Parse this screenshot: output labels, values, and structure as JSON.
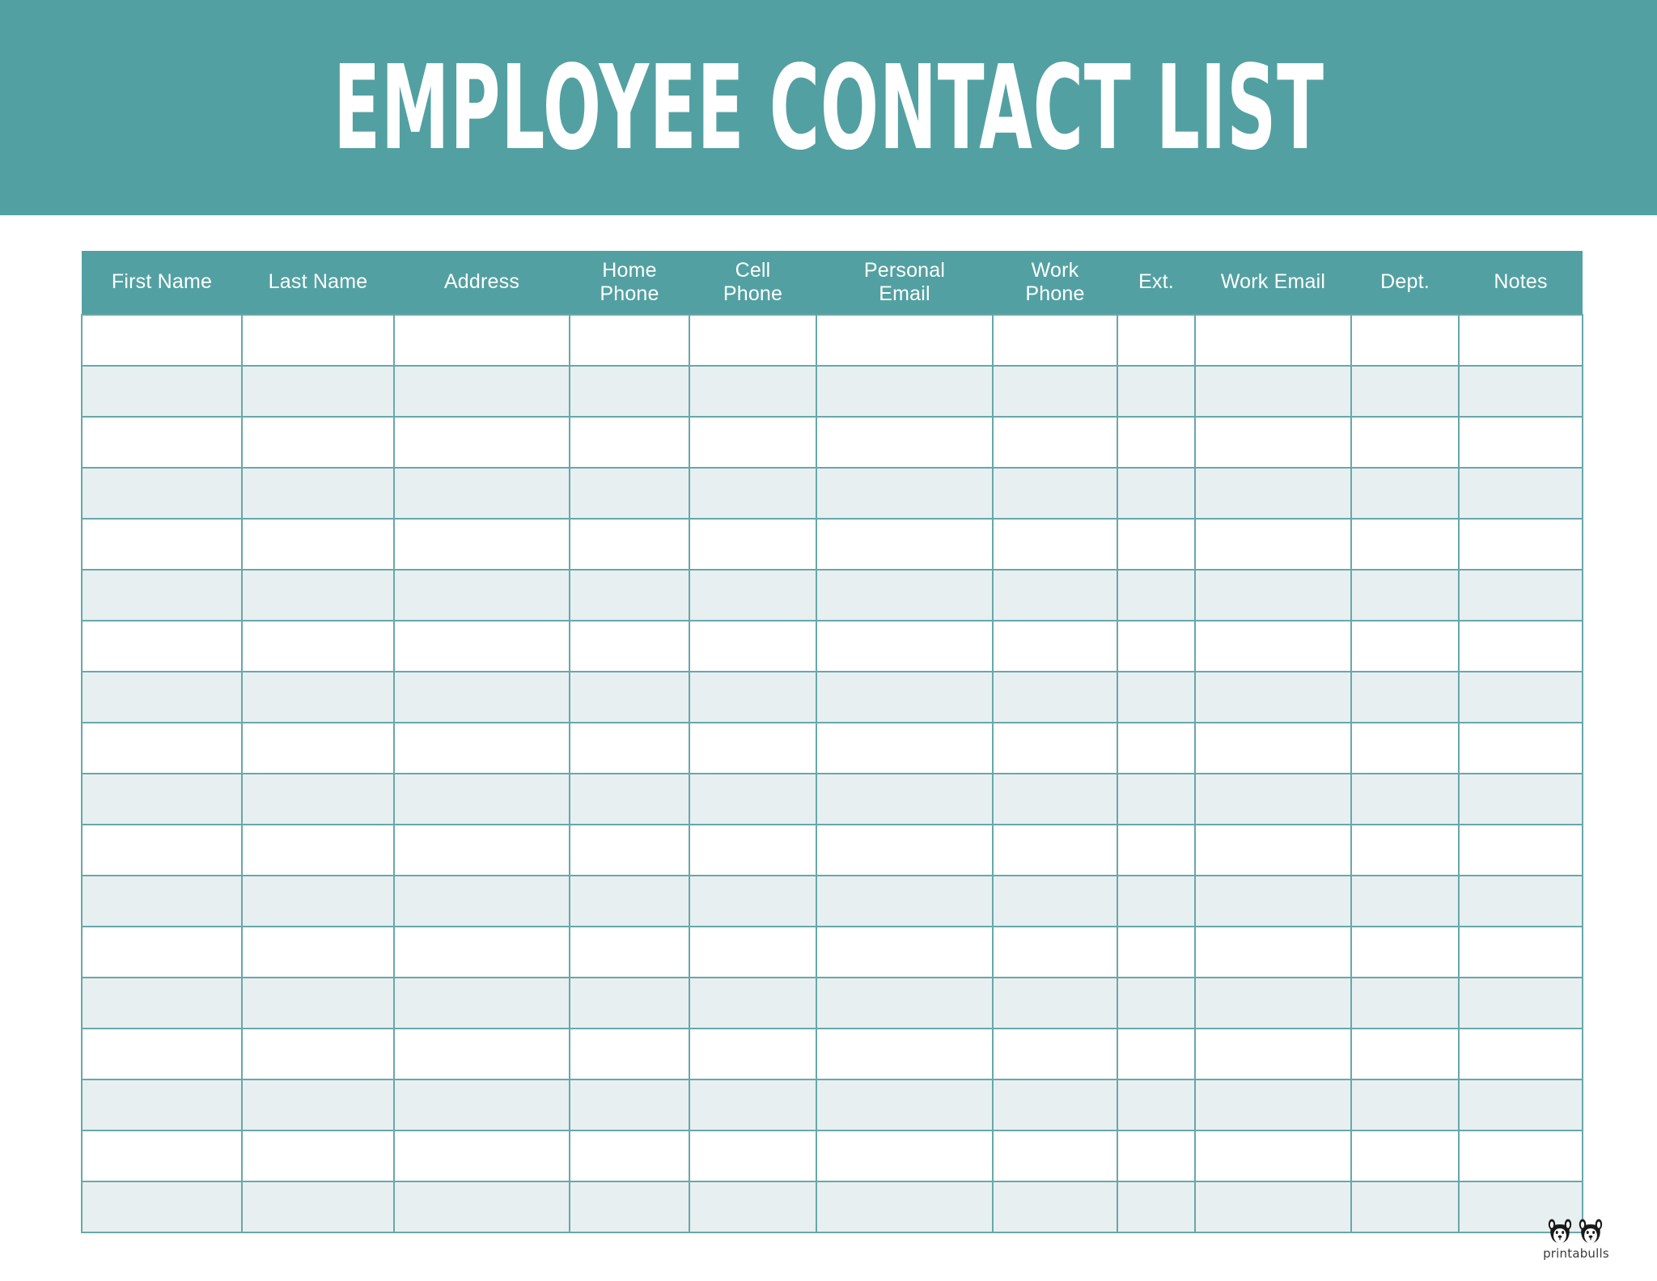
{
  "document": {
    "title": "EMPLOYEE CONTACT LIST",
    "banner_color": "#53a0a2",
    "grid_line_color": "#67a8ab",
    "alt_row_color": "#e8eff0",
    "page_background": "#ffffff"
  },
  "table": {
    "columns": [
      {
        "label": "First Name",
        "key": "first_name"
      },
      {
        "label": "Last Name",
        "key": "last_name"
      },
      {
        "label": "Address",
        "key": "address"
      },
      {
        "label": "Home\nPhone",
        "line1": "Home",
        "line2": "Phone",
        "key": "home_phone"
      },
      {
        "label": "Cell\nPhone",
        "line1": "Cell",
        "line2": "Phone",
        "key": "cell_phone"
      },
      {
        "label": "Personal\nEmail",
        "line1": "Personal",
        "line2": "Email",
        "key": "personal_email"
      },
      {
        "label": "Work\nPhone",
        "line1": "Work",
        "line2": "Phone",
        "key": "work_phone"
      },
      {
        "label": "Ext.",
        "key": "ext"
      },
      {
        "label": "Work Email",
        "key": "work_email"
      },
      {
        "label": "Dept.",
        "key": "dept"
      },
      {
        "label": "Notes",
        "key": "notes"
      }
    ],
    "row_count": 18,
    "rows": [
      {
        "first_name": "",
        "last_name": "",
        "address": "",
        "home_phone": "",
        "cell_phone": "",
        "personal_email": "",
        "work_phone": "",
        "ext": "",
        "work_email": "",
        "dept": "",
        "notes": ""
      },
      {
        "first_name": "",
        "last_name": "",
        "address": "",
        "home_phone": "",
        "cell_phone": "",
        "personal_email": "",
        "work_phone": "",
        "ext": "",
        "work_email": "",
        "dept": "",
        "notes": ""
      },
      {
        "first_name": "",
        "last_name": "",
        "address": "",
        "home_phone": "",
        "cell_phone": "",
        "personal_email": "",
        "work_phone": "",
        "ext": "",
        "work_email": "",
        "dept": "",
        "notes": ""
      },
      {
        "first_name": "",
        "last_name": "",
        "address": "",
        "home_phone": "",
        "cell_phone": "",
        "personal_email": "",
        "work_phone": "",
        "ext": "",
        "work_email": "",
        "dept": "",
        "notes": ""
      },
      {
        "first_name": "",
        "last_name": "",
        "address": "",
        "home_phone": "",
        "cell_phone": "",
        "personal_email": "",
        "work_phone": "",
        "ext": "",
        "work_email": "",
        "dept": "",
        "notes": ""
      },
      {
        "first_name": "",
        "last_name": "",
        "address": "",
        "home_phone": "",
        "cell_phone": "",
        "personal_email": "",
        "work_phone": "",
        "ext": "",
        "work_email": "",
        "dept": "",
        "notes": ""
      },
      {
        "first_name": "",
        "last_name": "",
        "address": "",
        "home_phone": "",
        "cell_phone": "",
        "personal_email": "",
        "work_phone": "",
        "ext": "",
        "work_email": "",
        "dept": "",
        "notes": ""
      },
      {
        "first_name": "",
        "last_name": "",
        "address": "",
        "home_phone": "",
        "cell_phone": "",
        "personal_email": "",
        "work_phone": "",
        "ext": "",
        "work_email": "",
        "dept": "",
        "notes": ""
      },
      {
        "first_name": "",
        "last_name": "",
        "address": "",
        "home_phone": "",
        "cell_phone": "",
        "personal_email": "",
        "work_phone": "",
        "ext": "",
        "work_email": "",
        "dept": "",
        "notes": ""
      },
      {
        "first_name": "",
        "last_name": "",
        "address": "",
        "home_phone": "",
        "cell_phone": "",
        "personal_email": "",
        "work_phone": "",
        "ext": "",
        "work_email": "",
        "dept": "",
        "notes": ""
      },
      {
        "first_name": "",
        "last_name": "",
        "address": "",
        "home_phone": "",
        "cell_phone": "",
        "personal_email": "",
        "work_phone": "",
        "ext": "",
        "work_email": "",
        "dept": "",
        "notes": ""
      },
      {
        "first_name": "",
        "last_name": "",
        "address": "",
        "home_phone": "",
        "cell_phone": "",
        "personal_email": "",
        "work_phone": "",
        "ext": "",
        "work_email": "",
        "dept": "",
        "notes": ""
      },
      {
        "first_name": "",
        "last_name": "",
        "address": "",
        "home_phone": "",
        "cell_phone": "",
        "personal_email": "",
        "work_phone": "",
        "ext": "",
        "work_email": "",
        "dept": "",
        "notes": ""
      },
      {
        "first_name": "",
        "last_name": "",
        "address": "",
        "home_phone": "",
        "cell_phone": "",
        "personal_email": "",
        "work_phone": "",
        "ext": "",
        "work_email": "",
        "dept": "",
        "notes": ""
      },
      {
        "first_name": "",
        "last_name": "",
        "address": "",
        "home_phone": "",
        "cell_phone": "",
        "personal_email": "",
        "work_phone": "",
        "ext": "",
        "work_email": "",
        "dept": "",
        "notes": ""
      },
      {
        "first_name": "",
        "last_name": "",
        "address": "",
        "home_phone": "",
        "cell_phone": "",
        "personal_email": "",
        "work_phone": "",
        "ext": "",
        "work_email": "",
        "dept": "",
        "notes": ""
      },
      {
        "first_name": "",
        "last_name": "",
        "address": "",
        "home_phone": "",
        "cell_phone": "",
        "personal_email": "",
        "work_phone": "",
        "ext": "",
        "work_email": "",
        "dept": "",
        "notes": ""
      },
      {
        "first_name": "",
        "last_name": "",
        "address": "",
        "home_phone": "",
        "cell_phone": "",
        "personal_email": "",
        "work_phone": "",
        "ext": "",
        "work_email": "",
        "dept": "",
        "notes": ""
      }
    ]
  },
  "logo": {
    "text": "printabulls",
    "mark": "two-bulldog-faces-icon"
  }
}
